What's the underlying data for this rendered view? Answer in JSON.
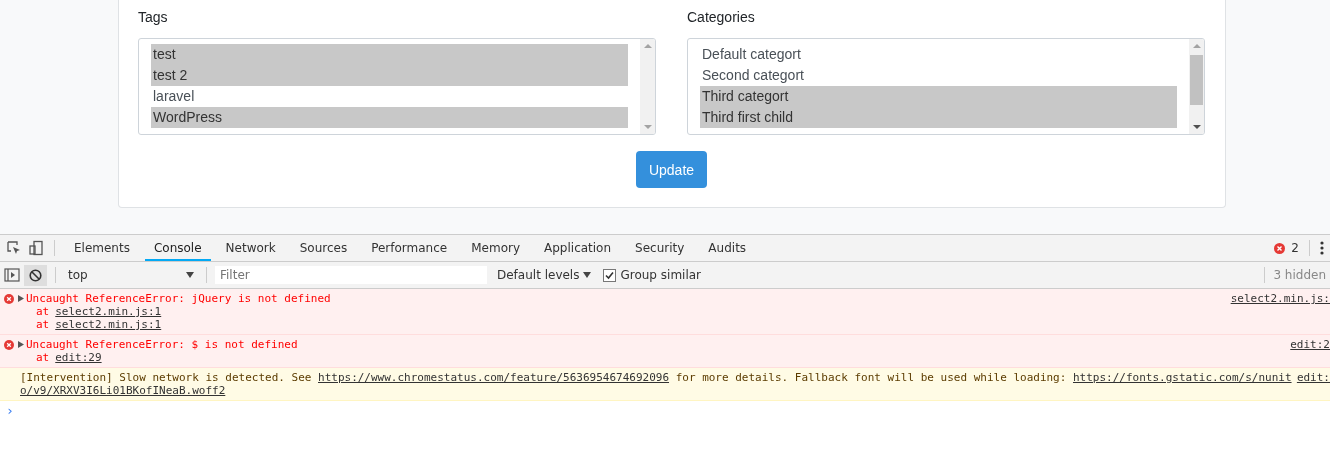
{
  "form": {
    "fields": [
      {
        "label": "Tags",
        "options": [
          {
            "text": "test",
            "selected": true
          },
          {
            "text": "test 2",
            "selected": true
          },
          {
            "text": "laravel",
            "selected": false
          },
          {
            "text": "WordPress",
            "selected": true
          }
        ]
      },
      {
        "label": "Categories",
        "options": [
          {
            "text": "Default categort",
            "selected": false
          },
          {
            "text": "Second categort",
            "selected": false
          },
          {
            "text": "Third categort",
            "selected": true
          },
          {
            "text": "Third first child",
            "selected": true
          }
        ]
      }
    ],
    "submit": "Update"
  },
  "devtools": {
    "tabs": [
      {
        "label": "Elements",
        "selected": false
      },
      {
        "label": "Console",
        "selected": true
      },
      {
        "label": "Network",
        "selected": false
      },
      {
        "label": "Sources",
        "selected": false
      },
      {
        "label": "Performance",
        "selected": false
      },
      {
        "label": "Memory",
        "selected": false
      },
      {
        "label": "Application",
        "selected": false
      },
      {
        "label": "Security",
        "selected": false
      },
      {
        "label": "Audits",
        "selected": false
      }
    ],
    "error_count": "2",
    "toolbar": {
      "context": "top",
      "filter_placeholder": "Filter",
      "levels": "Default levels",
      "group_similar": {
        "label": "Group similar",
        "checked": true
      },
      "hidden": "3 hidden"
    },
    "messages": [
      {
        "kind": "error",
        "text": "Uncaught ReferenceError: jQuery is not defined",
        "stack": [
          {
            "prefix": "at",
            "link": "select2.min.js:1"
          },
          {
            "prefix": "at",
            "link": "select2.min.js:1"
          }
        ],
        "source": "select2.min.js:"
      },
      {
        "kind": "error",
        "text": "Uncaught ReferenceError: $ is not defined",
        "stack": [
          {
            "prefix": "at",
            "link": "edit:29"
          }
        ],
        "source": "edit:2"
      },
      {
        "kind": "warning",
        "parts": [
          "[Intervention] Slow network is detected. See ",
          "https://www.chromestatus.com/feature/5636954674692096",
          " for more details. Fallback font will be used while loading: ",
          "https://fonts.gstatic.com/s/nunit",
          "o/v9/XRXV3I6Li01BKofINeaB.woff2"
        ],
        "source": "edit:"
      }
    ],
    "prompt": "›"
  }
}
